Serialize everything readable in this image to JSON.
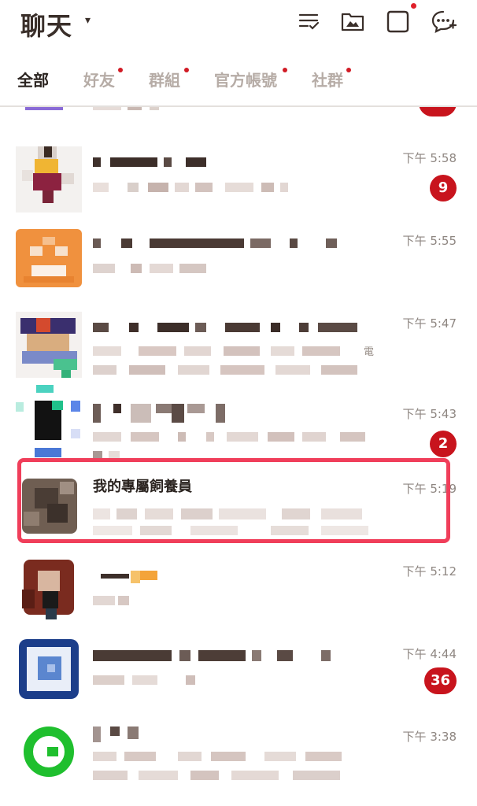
{
  "header": {
    "title": "聊天",
    "caret": "▾",
    "icons": [
      "sort-list-icon",
      "album-icon",
      "square-icon",
      "add-chat-icon"
    ],
    "accent_dot_color": "#e0202a"
  },
  "tabs": [
    {
      "label": "全部",
      "active": true,
      "dot": false
    },
    {
      "label": "好友",
      "active": false,
      "dot": true
    },
    {
      "label": "群組",
      "active": false,
      "dot": true
    },
    {
      "label": "官方帳號",
      "active": false,
      "dot": true
    },
    {
      "label": "社群",
      "active": false,
      "dot": true
    }
  ],
  "chats": [
    {
      "name": "",
      "time": "下午 5:58",
      "badge": "9"
    },
    {
      "name": "",
      "time": "下午 5:55",
      "badge": ""
    },
    {
      "name": "",
      "time": "下午 5:47",
      "badge": "",
      "preview_tail": "電"
    },
    {
      "name": "",
      "time": "下午 5:43",
      "badge": "2"
    },
    {
      "name": "我的專屬飼養員",
      "time": "下午 5:19",
      "badge": "",
      "highlighted": true
    },
    {
      "name": "",
      "time": "下午 5:12",
      "badge": ""
    },
    {
      "name": "",
      "time": "下午 4:44",
      "badge": "36"
    },
    {
      "name": "",
      "time": "下午 3:38",
      "badge": ""
    }
  ],
  "colors": {
    "badge": "#c8141d",
    "highlight_border": "#f03e5a"
  }
}
